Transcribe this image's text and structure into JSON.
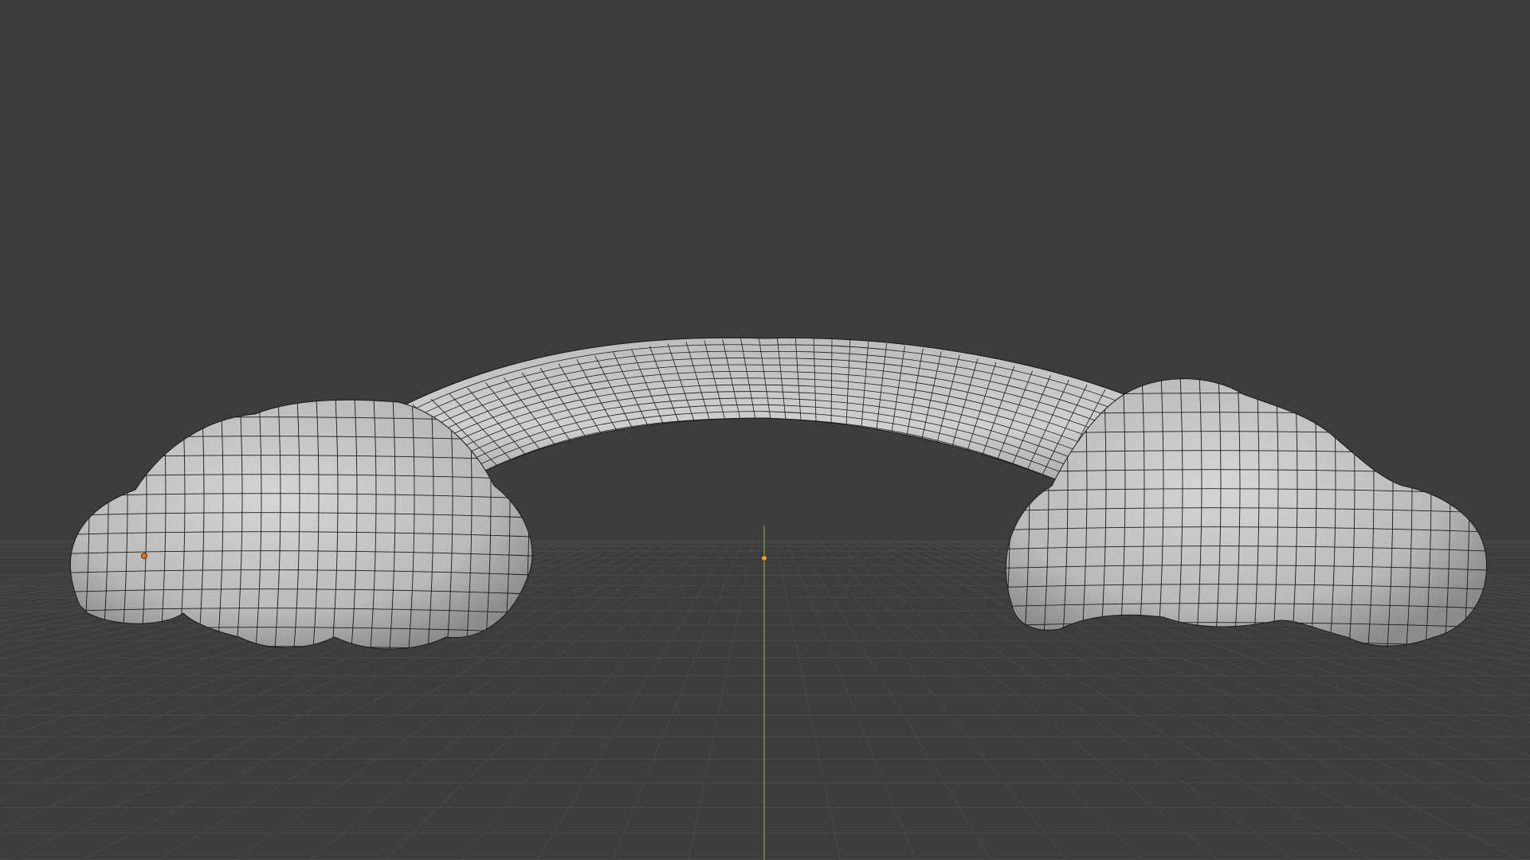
{
  "viewport": {
    "background_color": "#3d3d3d",
    "grid_color": "#4a4a4a",
    "axis_y_color": "#6f8f3f",
    "origin_color": "#f29a1d",
    "vertex_color": "#ff6a00",
    "mesh_fill_color": "#c4c4c4",
    "mesh_wire_color": "#1a1a1a",
    "view_mode": "solid-with-wireframe",
    "objects": [
      "left-cloud",
      "right-cloud",
      "rainbow-arc"
    ]
  }
}
